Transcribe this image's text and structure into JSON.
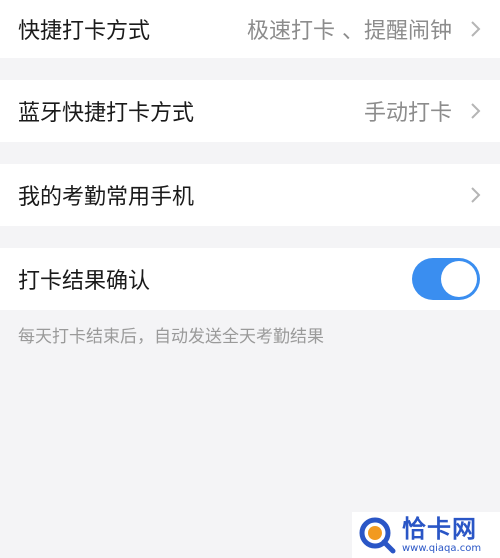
{
  "settings": {
    "quick_punch": {
      "label": "快捷打卡方式",
      "value": "极速打卡 、提醒闹钟"
    },
    "bluetooth_punch": {
      "label": "蓝牙快捷打卡方式",
      "value": "手动打卡"
    },
    "common_phone": {
      "label": "我的考勤常用手机"
    },
    "punch_confirm": {
      "label": "打卡结果确认",
      "enabled": true
    }
  },
  "hint": "每天打卡结束后，自动发送全天考勤结果",
  "watermark": {
    "name": "恰卡网",
    "url": "www.qiaqa.com"
  },
  "colors": {
    "background": "#f4f4f6",
    "toggle_on": "#3a8ef0",
    "chevron": "#b5b5b5",
    "watermark": "#2a56c6"
  }
}
